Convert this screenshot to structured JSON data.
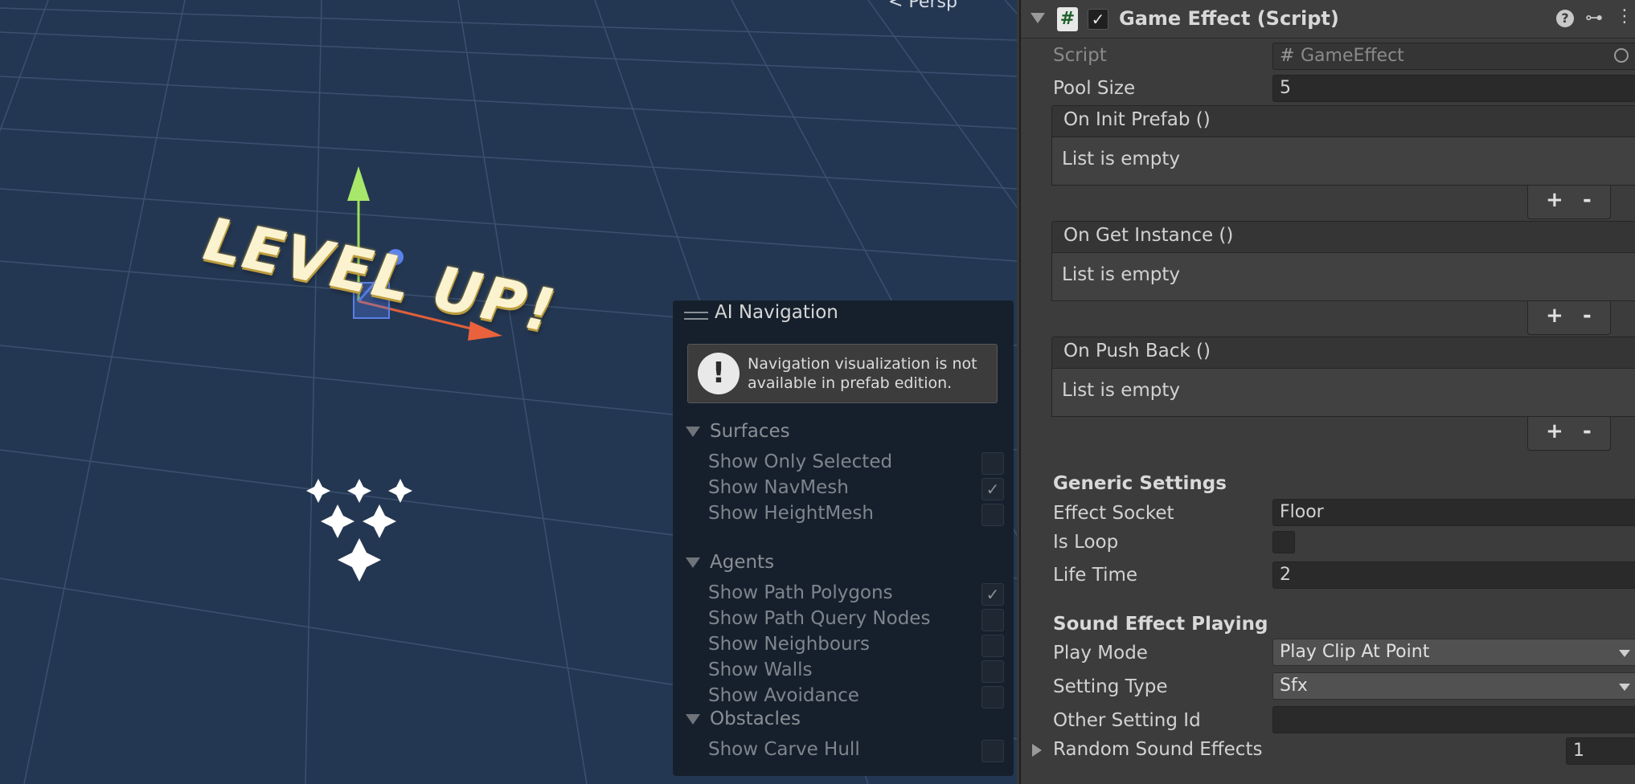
{
  "scene": {
    "persp_label": "< Persp",
    "level_up_text": "LEVEL UP!",
    "ai_navigation": {
      "title": "AI Navigation",
      "notice": "Navigation visualization is not available in prefab edition.",
      "sections": [
        {
          "label": "Surfaces",
          "options": [
            {
              "label": "Show Only Selected",
              "checked": false
            },
            {
              "label": "Show NavMesh",
              "checked": true
            },
            {
              "label": "Show HeightMesh",
              "checked": false
            }
          ]
        },
        {
          "label": "Agents",
          "options": [
            {
              "label": "Show Path Polygons",
              "checked": true
            },
            {
              "label": "Show Path Query Nodes",
              "checked": false
            },
            {
              "label": "Show Neighbours",
              "checked": false
            },
            {
              "label": "Show Walls",
              "checked": false
            },
            {
              "label": "Show Avoidance",
              "checked": false
            }
          ]
        },
        {
          "label": "Obstacles",
          "options": [
            {
              "label": "Show Carve Hull",
              "checked": false
            }
          ]
        }
      ]
    }
  },
  "inspector": {
    "component_title": "Game Effect (Script)",
    "hash_icon": "#",
    "check_mark": "✓",
    "presets_icon": "⊶",
    "menu_icon": "⋮",
    "script_label": "Script",
    "script_value": "GameEffect",
    "pool_size_label": "Pool Size",
    "pool_size_value": "5",
    "events": [
      {
        "title": "On Init Prefab ()",
        "body": "List is empty"
      },
      {
        "title": "On Get Instance ()",
        "body": "List is empty"
      },
      {
        "title": "On Push Back ()",
        "body": "List is empty"
      }
    ],
    "plus": "+",
    "minus": "-",
    "generic_settings_header": "Generic Settings",
    "effect_socket_label": "Effect Socket",
    "effect_socket_value": "Floor",
    "is_loop_label": "Is Loop",
    "life_time_label": "Life Time",
    "life_time_value": "2",
    "sound_header": "Sound Effect Playing",
    "play_mode_label": "Play Mode",
    "play_mode_value": "Play Clip At Point",
    "setting_type_label": "Setting Type",
    "setting_type_value": "Sfx",
    "other_setting_label": "Other Setting Id",
    "other_setting_value": "",
    "random_sfx_label": "Random Sound Effects",
    "random_sfx_count": "1"
  }
}
